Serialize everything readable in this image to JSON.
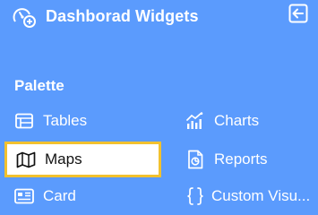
{
  "header": {
    "title": "Dashborad Widgets",
    "logo_icon": "dashboard-add-icon",
    "collapse_icon": "collapse-left-icon"
  },
  "palette": {
    "title": "Palette",
    "items": [
      {
        "label": "Tables",
        "icon": "table-icon",
        "selected": false
      },
      {
        "label": "Charts",
        "icon": "chart-icon",
        "selected": false
      },
      {
        "label": "Maps",
        "icon": "map-icon",
        "selected": true
      },
      {
        "label": "Reports",
        "icon": "report-icon",
        "selected": false
      },
      {
        "label": "Card",
        "icon": "card-icon",
        "selected": false
      },
      {
        "label": "Custom Visu...",
        "icon": "custom-code-icon",
        "selected": false
      }
    ]
  },
  "colors": {
    "background": "#5b9bfd",
    "text": "#ffffff",
    "selected_background": "#ffffff",
    "selected_border": "#f2c12e",
    "selected_text": "#111111"
  }
}
